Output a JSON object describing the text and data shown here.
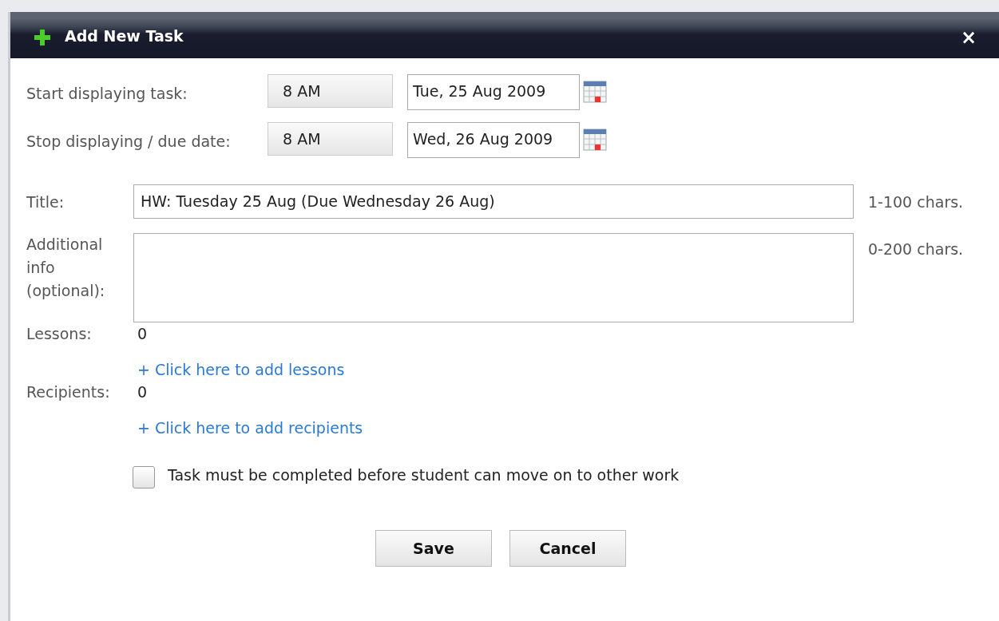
{
  "dialog": {
    "title": "Add New Task",
    "close": "×"
  },
  "schedule": [
    {
      "label": "Start displaying task:",
      "time": "8 AM",
      "date": "Tue, 25 Aug 2009"
    },
    {
      "label": "Stop displaying / due date:",
      "time": "8 AM",
      "date": "Wed, 26 Aug 2009"
    }
  ],
  "title_field": {
    "label": "Title:",
    "value": "HW: Tuesday 25 Aug (Due Wednesday 26 Aug)",
    "hint": "1-100 chars."
  },
  "info_field": {
    "label": "Additional info (optional):",
    "hint": "0-200 chars."
  },
  "lessons": {
    "label": "Lessons:",
    "count": "0",
    "link": "+ Click here to add lessons"
  },
  "recipients": {
    "label": "Recipients:",
    "count": "0",
    "link": "+ Click here to add recipients"
  },
  "must_complete": {
    "label": "Task must be completed before student can move on to other work",
    "checked": false
  },
  "buttons": [
    "Save",
    "Cancel"
  ]
}
